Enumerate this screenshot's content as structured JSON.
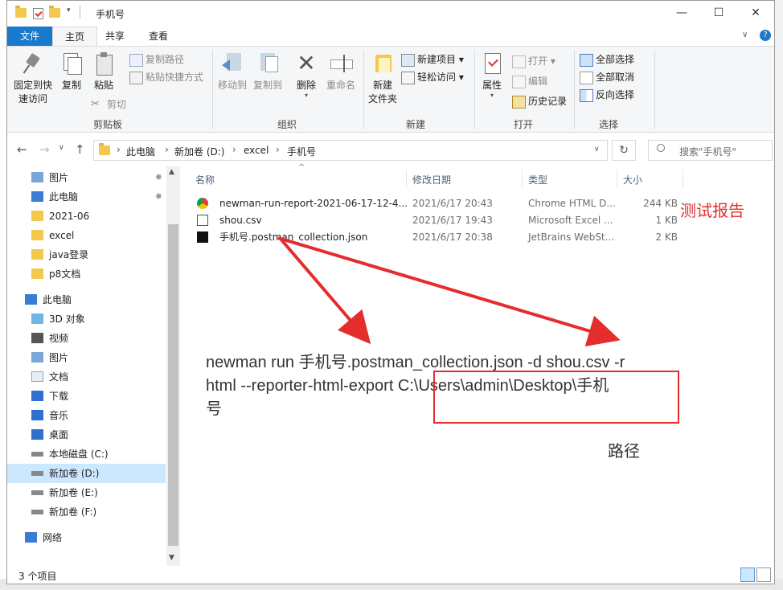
{
  "window": {
    "title": "手机号",
    "controls": {
      "minimize": "—",
      "maximize": "☐",
      "close": "✕"
    }
  },
  "ribbon_tabs": [
    "文件",
    "主页",
    "共享",
    "查看"
  ],
  "ribbon": {
    "clipboard": {
      "group_label": "剪贴板",
      "pin_quick": [
        "固定到快",
        "速访问"
      ],
      "copy": "复制",
      "paste": "粘贴",
      "copy_path": "复制路径",
      "paste_shortcut": "粘贴快捷方式",
      "cut": "剪切"
    },
    "organize": {
      "group_label": "组织",
      "move_to": "移动到",
      "copy_to": "复制到",
      "delete": "删除",
      "rename": "重命名"
    },
    "new": {
      "group_label": "新建",
      "new_folder": [
        "新建",
        "文件夹"
      ],
      "new_item": "新建项目 ▾",
      "easy_access": "轻松访问 ▾"
    },
    "open": {
      "group_label": "打开",
      "properties": "属性",
      "open": "打开 ▾",
      "edit": "编辑",
      "history": "历史记录"
    },
    "select": {
      "group_label": "选择",
      "select_all": "全部选择",
      "select_none": "全部取消",
      "invert": "反向选择"
    }
  },
  "address": {
    "crumbs": [
      "此电脑",
      "新加卷 (D:)",
      "excel",
      "手机号"
    ],
    "search_placeholder": "搜索\"手机号\""
  },
  "nav": {
    "items": [
      {
        "label": "图片",
        "icon": "pictures-icon",
        "pinned": true
      },
      {
        "label": "此电脑",
        "icon": "pc-icon",
        "pinned": true
      },
      {
        "label": "2021-06",
        "icon": "folder-icon"
      },
      {
        "label": "excel",
        "icon": "folder-icon"
      },
      {
        "label": "java登录",
        "icon": "folder-icon"
      },
      {
        "label": "p8文档",
        "icon": "folder-icon"
      },
      {
        "label": "此电脑",
        "icon": "pc-icon"
      },
      {
        "label": "3D 对象",
        "icon": "3d-objects-icon"
      },
      {
        "label": "视频",
        "icon": "videos-icon"
      },
      {
        "label": "图片",
        "icon": "pictures-icon"
      },
      {
        "label": "文档",
        "icon": "documents-icon"
      },
      {
        "label": "下载",
        "icon": "downloads-icon"
      },
      {
        "label": "音乐",
        "icon": "music-icon"
      },
      {
        "label": "桌面",
        "icon": "desktop-icon"
      },
      {
        "label": "本地磁盘 (C:)",
        "icon": "drive-icon"
      },
      {
        "label": "新加卷 (D:)",
        "icon": "drive-icon",
        "selected": true
      },
      {
        "label": "新加卷 (E:)",
        "icon": "drive-icon"
      },
      {
        "label": "新加卷 (F:)",
        "icon": "drive-icon"
      },
      {
        "label": "网络",
        "icon": "network-icon"
      }
    ]
  },
  "files": {
    "columns": [
      "名称",
      "修改日期",
      "类型",
      "大小"
    ],
    "rows": [
      {
        "name": "newman-run-report-2021-06-17-12-4...",
        "date": "2021/6/17 20:43",
        "type": "Chrome HTML D...",
        "size": "244 KB",
        "icon": "chrome-html-icon"
      },
      {
        "name": "shou.csv",
        "date": "2021/6/17 19:43",
        "type": "Microsoft Excel ...",
        "size": "1 KB",
        "icon": "excel-csv-icon"
      },
      {
        "name": "手机号.postman_collection.json",
        "date": "2021/6/17 20:38",
        "type": "JetBrains WebSt...",
        "size": "2 KB",
        "icon": "webstorm-json-icon"
      }
    ]
  },
  "status": {
    "count": "3 个项目"
  },
  "annotations": {
    "report_label": "测试报告",
    "command_lines": [
      "newman run 手机号.postman_collection.json -d shou.csv -r",
      "html --reporter-html-export C:\\Users\\admin\\Desktop\\手机",
      "号"
    ],
    "path_label": "路径",
    "color": "#e52d2d"
  }
}
